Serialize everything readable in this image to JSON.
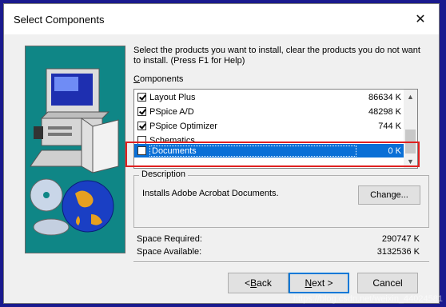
{
  "window": {
    "title": "Select Components",
    "close_glyph": "✕"
  },
  "intro": "Select the products you want to install, clear the products you do not want to install. (Press F1 for Help)",
  "components": {
    "label_prefix": "C",
    "label_rest": "omponents",
    "items": [
      {
        "name": "Layout Plus",
        "size": "86634 K",
        "checked": true
      },
      {
        "name": "PSpice A/D",
        "size": "48298 K",
        "checked": true
      },
      {
        "name": "PSpice Optimizer",
        "size": "744 K",
        "checked": true
      },
      {
        "name": "Schematics",
        "size": "",
        "checked": false
      },
      {
        "name": "Documents",
        "size": "0 K",
        "checked": false,
        "selected": true
      }
    ],
    "scroll_up_icon": "▲",
    "scroll_down_icon": "▼"
  },
  "description": {
    "legend": "Description",
    "text": "Installs Adobe Acrobat Documents.",
    "change_button": "Change..."
  },
  "space": {
    "required_label": "Space Required:",
    "required_value": "290747 K",
    "available_label": "Space Available:",
    "available_value": "3132536 K"
  },
  "buttons": {
    "back_prefix": "< ",
    "back_ul": "B",
    "back_rest": "ack",
    "next_ul": "N",
    "next_rest": "ext >",
    "cancel": "Cancel"
  },
  "watermark": "https://blog.csdn.net/weixin_44024581",
  "colors": {
    "selection": "#0a6fd6",
    "highlight": "#e02020",
    "art_bg": "#0f8686",
    "desktop": "#1a1a8e"
  }
}
